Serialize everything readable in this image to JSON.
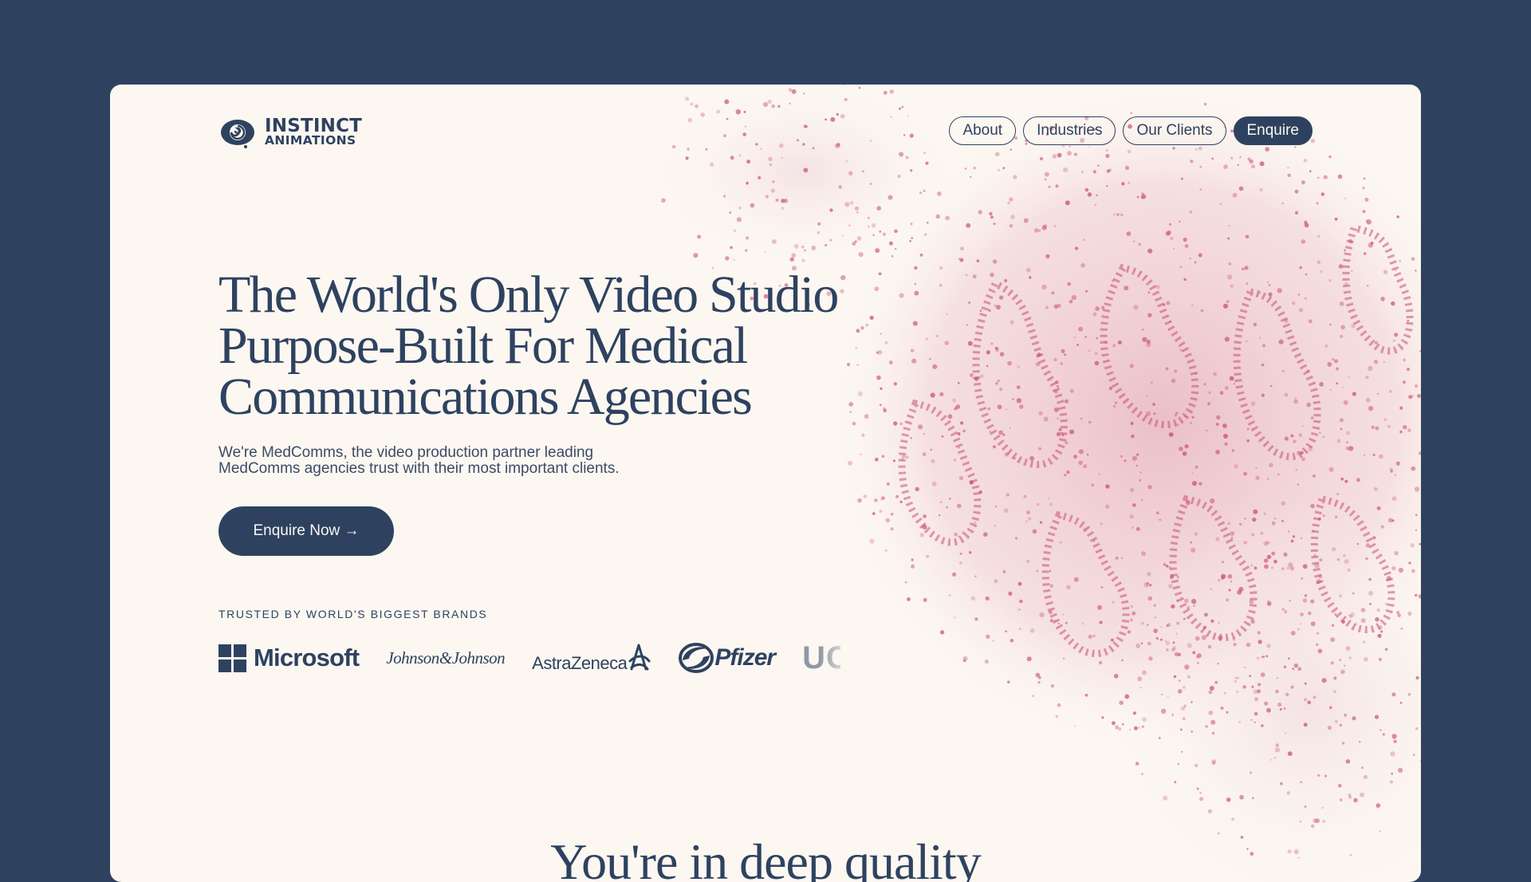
{
  "brand": {
    "line1": "INSTINCT",
    "line2": "ANIMATIONS"
  },
  "nav": {
    "items": [
      {
        "label": "About"
      },
      {
        "label": "Industries"
      },
      {
        "label": "Our Clients"
      }
    ],
    "enquire_label": "Enquire"
  },
  "hero": {
    "title_lines": [
      "The World's Only Video Studio",
      "Purpose-Built For Medical",
      "Communications Agencies"
    ],
    "subtitle_lines": [
      "We're MedComms,  the video production partner leading",
      "MedComms agencies trust with their most important clients."
    ],
    "cta_label": "Enquire Now →"
  },
  "trusted": {
    "label": "TRUSTED BY WORLD'S BIGGEST BRANDS",
    "brands": [
      "Microsoft",
      "Johnson&Johnson",
      "AstraZeneca",
      "Pfizer",
      "UCL"
    ]
  },
  "next_section": {
    "heading": "You're in deep quality"
  },
  "colors": {
    "page_bg": "#2e4260",
    "card_bg": "#fcf7f1",
    "primary": "#2e4260",
    "tissue_pink": "#c8506e"
  },
  "icons": [
    "instinct-swirl-logo-icon",
    "microsoft-grid-icon",
    "astrazeneca-symbol-icon",
    "pfizer-swirl-icon"
  ]
}
